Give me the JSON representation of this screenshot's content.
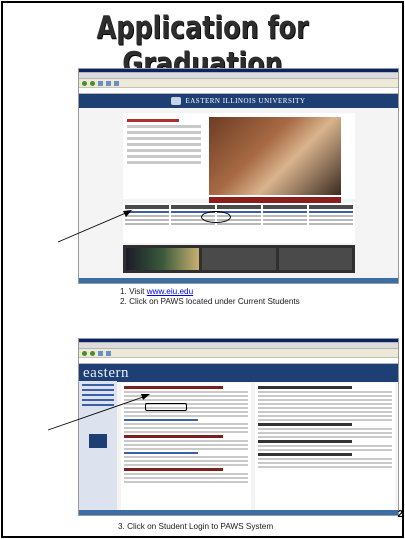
{
  "slide": {
    "title": "Application for Graduation",
    "page_number": "2"
  },
  "screenshot1": {
    "university_name": "EASTERN ILLINOIS UNIVERSITY"
  },
  "screenshot2": {
    "site_wordmark": "eastern"
  },
  "instructions": {
    "step1_prefix": "1.  Visit ",
    "step1_link": "www.eiu.edu",
    "step2": "2.   Click on PAWS located under Current Students",
    "step3": "3.  Click on Student Login to PAWS System"
  }
}
